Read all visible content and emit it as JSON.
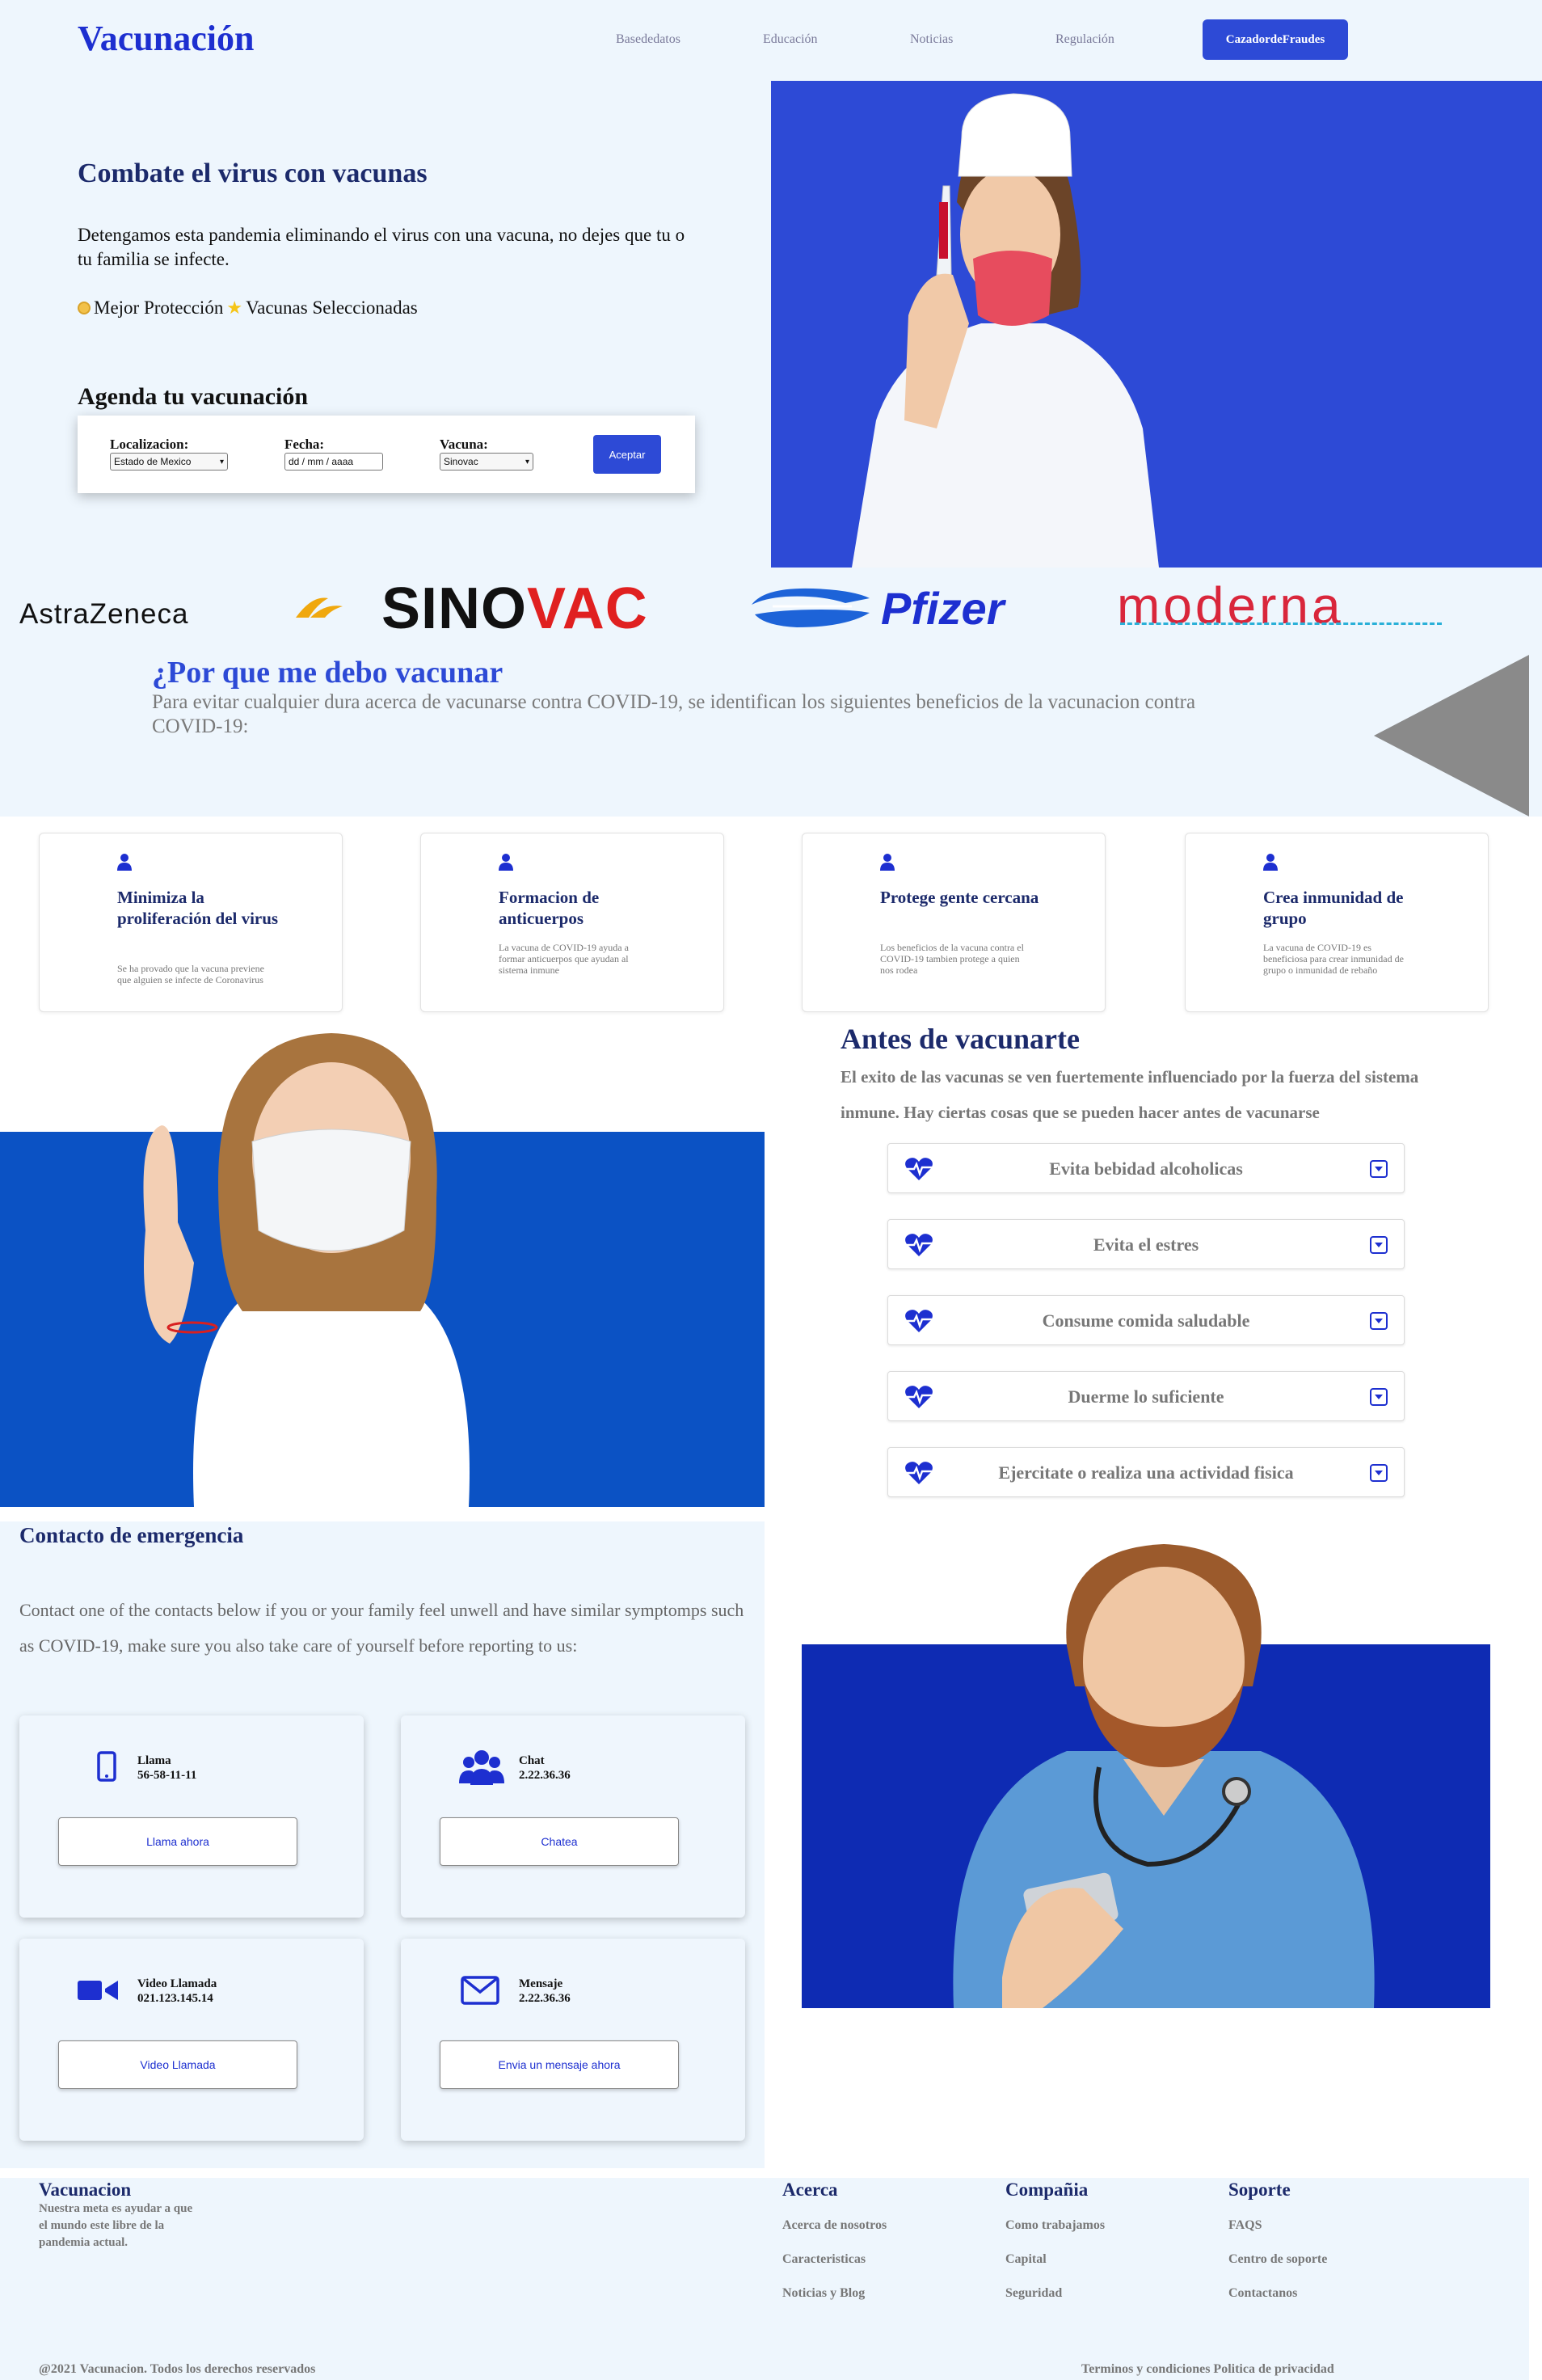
{
  "header": {
    "logo": "Vacunación",
    "nav": [
      "Basededatos",
      "Educación",
      "Noticias",
      "Regulación"
    ],
    "cta": "CazadordeFraudes"
  },
  "hero": {
    "title": "Combate el virus con vacunas",
    "description": "Detengamos esta pandemia eliminando el virus con una vacuna, no dejes que tu o tu familia se infecte.",
    "badge1": "Mejor Protección",
    "badge2": "Vacunas Seleccionadas",
    "schedule_title": "Agenda tu vacunación"
  },
  "form": {
    "location_label": "Localizacion:",
    "location_value": "Estado de Mexico",
    "date_label": "Fecha:",
    "date_placeholder": "dd / mm / aaaa",
    "vaccine_label": "Vacuna:",
    "vaccine_value": "Sinovac",
    "submit": "Aceptar"
  },
  "brands": [
    "AstraZeneca",
    "SINOVAC",
    "Pfizer",
    "moderna"
  ],
  "why": {
    "title": "¿Por que me debo vacunar",
    "description": "Para evitar cualquier dura acerca de vacunarse contra COVID-19, se identifican los siguientes beneficios de la vacunacion contra COVID-19:"
  },
  "benefits": [
    {
      "title": "Minimiza la proliferación del virus",
      "text": "Se ha provado que la vacuna previene que alguien se infecte de Coronavirus"
    },
    {
      "title": "Formacion de anticuerpos",
      "text": "La vacuna de COVID-19 ayuda a formar anticuerpos que ayudan al sistema inmune"
    },
    {
      "title": "Protege gente cercana",
      "text": "Los beneficios de la vacuna contra el COVID-19 tambien protege a quien nos rodea"
    },
    {
      "title": "Crea inmunidad de grupo",
      "text": "La vacuna de COVID-19 es beneficiosa para crear inmunidad de grupo o inmunidad de rebaño"
    }
  ],
  "before": {
    "title": "Antes de vacunarte",
    "description": "El exito de las vacunas se ven fuertemente influenciado por la fuerza del sistema inmune. Hay ciertas cosas que se pueden hacer antes de vacunarse",
    "items": [
      "Evita bebidad alcoholicas",
      "Evita el estres",
      "Consume comida saludable",
      "Duerme lo suficiente",
      "Ejercitate o realiza una actividad fisica"
    ]
  },
  "emergency": {
    "title": "Contacto de emergencia",
    "description": "Contact one of the contacts below if you or your family feel unwell and have similar symptomps such as COVID-19, make sure you also take care of yourself before reporting to us:",
    "cards": [
      {
        "title": "Llama",
        "value": "56-58-11-11",
        "button": "Llama ahora"
      },
      {
        "title": "Chat",
        "value": "2.22.36.36",
        "button": "Chatea"
      },
      {
        "title": "Video Llamada",
        "value": "021.123.145.14",
        "button": "Video Llamada"
      },
      {
        "title": "Mensaje",
        "value": "2.22.36.36",
        "button": "Envia un mensaje ahora"
      }
    ]
  },
  "footer": {
    "brand": "Vacunacion",
    "mission": "Nuestra meta es ayudar a que el mundo este libre de la pandemia actual.",
    "columns": [
      {
        "title": "Acerca",
        "links": [
          "Acerca de nosotros",
          "Caracteristicas",
          "Noticias y Blog"
        ]
      },
      {
        "title": "Compañia",
        "links": [
          "Como trabajamos",
          "Capital",
          "Seguridad"
        ]
      },
      {
        "title": "Soporte",
        "links": [
          "FAQS",
          "Centro de soporte",
          "Contactanos"
        ]
      }
    ],
    "copyright": "@2021 Vacunacion. Todos los derechos reservados",
    "terms": "Terminos y condiciones",
    "privacy": "Politica de privacidad"
  },
  "colors": {
    "accent": "#2d4ad6",
    "navy": "#1c2a6b",
    "light_bg": "#eef6fd",
    "royal_blue": "#0b52c4"
  }
}
